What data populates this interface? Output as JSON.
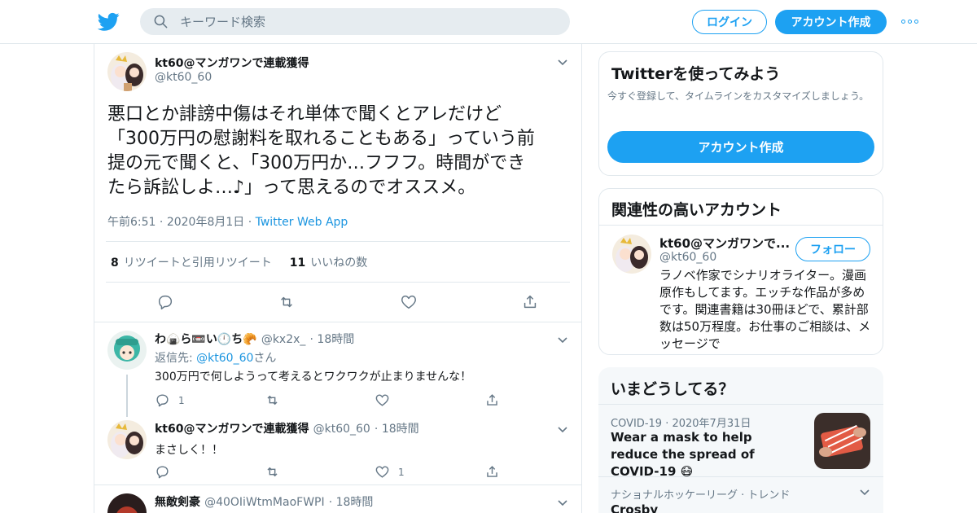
{
  "header": {
    "search_placeholder": "キーワード検索",
    "login_label": "ログイン",
    "signup_label": "アカウント作成"
  },
  "main_tweet": {
    "author_name": "kt60@マンガワンで連載獲得",
    "author_handle": "@kt60_60",
    "text_lines": [
      "悪口とか誹謗中傷はそれ単体で聞くとアレだけど",
      "「300万円の慰謝料を取れることもある」っていう前",
      "提の元で聞くと、「300万円か…フフフ。時間ができ",
      "たら訴訟しよ…♪」って思えるのでオススメ。"
    ],
    "time": "午前6:51",
    "date": "2020年8月1日",
    "source": "Twitter Web App",
    "retweets": "8",
    "retweets_label": "リツイートと引用リツイート",
    "likes": "11",
    "likes_label": "いいねの数"
  },
  "replies": [
    {
      "author_name": "わ🍙ら📼い🕛ち🥐",
      "author_handle": "@kx2x_",
      "time": "18時間",
      "reply_to_prefix": "返信先: ",
      "reply_to_handle": "@kt60_60",
      "reply_to_suffix": "さん",
      "text": "300万円で何しようって考えるとワクワクが止まりませんな！",
      "reply_count": "1",
      "retweet_count": "",
      "like_count": ""
    },
    {
      "author_name": "kt60@マンガワンで連載獲得",
      "author_handle": "@kt60_60",
      "time": "18時間",
      "text": "まさしく！！",
      "reply_count": "",
      "retweet_count": "",
      "like_count": "1"
    },
    {
      "author_name": "無敵剣豪",
      "author_handle": "@40OIiWtmMaoFWPI",
      "time": "18時間"
    }
  ],
  "sidebar": {
    "try_title": "Twitterを使ってみよう",
    "try_subtitle": "今すぐ登録して、タイムラインをカスタマイズしましょう。",
    "try_button": "アカウント作成",
    "related_title": "関連性の高いアカウント",
    "related_name": "kt60@マンガワンで...",
    "related_handle": "@kt60_60",
    "follow_label": "フォロー",
    "related_bio": "ラノベ作家でシナリオライター。漫画原作もしてます。エッチな作品が多めです。関連書籍は30冊ほどで、累計部数は50万程度。お仕事のご相談は、メッセージで",
    "trends_title": "いまどうしてる？",
    "trend1_category": "COVID-19",
    "trend1_date": "2020年7月31日",
    "trend1_text": "Wear a mask to help reduce the spread of COVID-19 😷",
    "trend2_category": "ナショナルホッケーリーグ · トレンド",
    "trend2_title": "Crosby"
  },
  "colors": {
    "accent": "#1da1f2",
    "link": "#1b95e0",
    "muted": "#657786",
    "border": "#e1e8ed"
  }
}
